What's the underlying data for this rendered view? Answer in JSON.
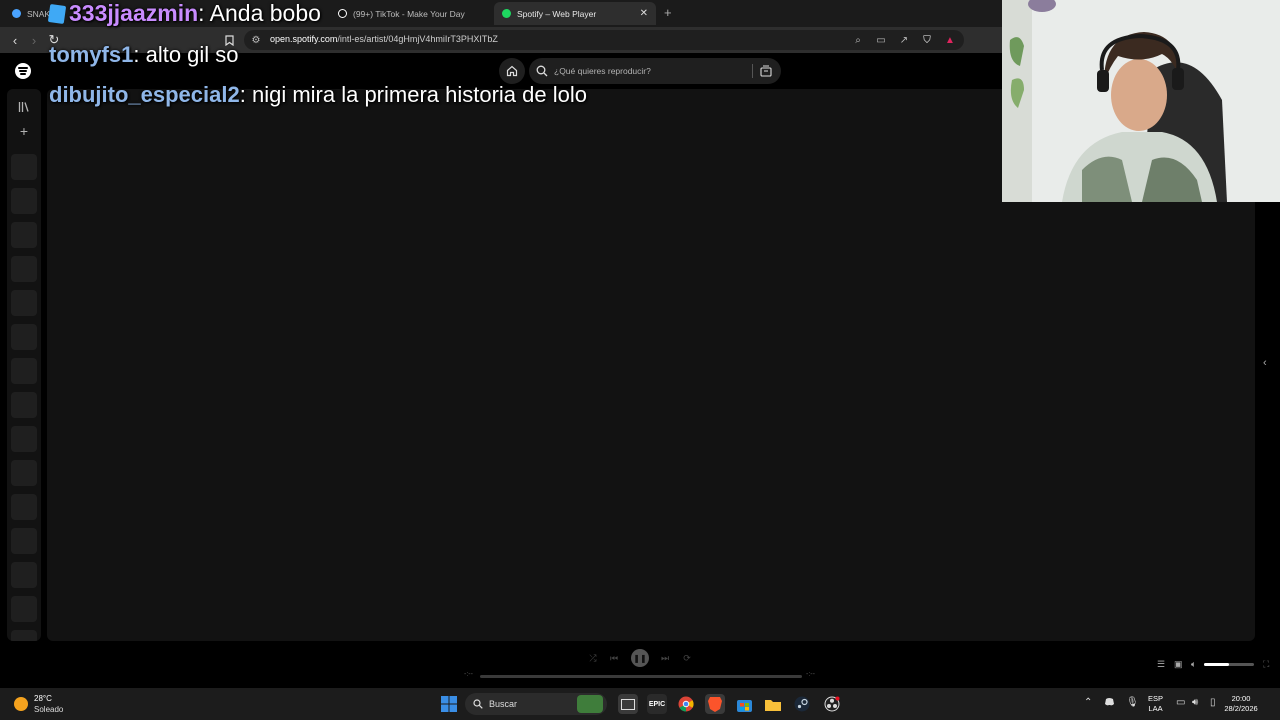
{
  "browser": {
    "tabs": [
      {
        "label": "SNAKE",
        "active": false
      },
      {
        "label": "(99+) TikTok - Make Your Day",
        "active": false
      },
      {
        "label": "Spotify – Web Player",
        "active": true
      }
    ],
    "url_host": "open.spotify.com",
    "url_path": "/intl-es/artist/04gHmjV4hmiIrT3PHXITbZ"
  },
  "spotify": {
    "search_placeholder": "¿Qué quieres reproducir?",
    "player": {
      "time_elapsed": "-:--",
      "time_total": "-:--",
      "volume_level": 0.5
    }
  },
  "chat": [
    {
      "user": "333jjaazmin",
      "message": ": Anda bobo",
      "color": "#c98cff"
    },
    {
      "user": "tomyfs1",
      "message": ": alto gil so",
      "color": "#8fb6e8"
    },
    {
      "user": "dibujito_especial2",
      "message": ": nigi mira la primera historia de lolo",
      "color": "#8fb6e8"
    }
  ],
  "taskbar": {
    "weather_temp": "28°C",
    "weather_desc": "Soleado",
    "search_label": "Buscar",
    "lang_line1": "ESP",
    "lang_line2": "LAA",
    "time": "20:00",
    "date": "28/2/2026"
  },
  "colors": {
    "spotify_bg": "#121212",
    "windows_blue": "#3a8ee6",
    "brave_orange": "#fb542b"
  }
}
